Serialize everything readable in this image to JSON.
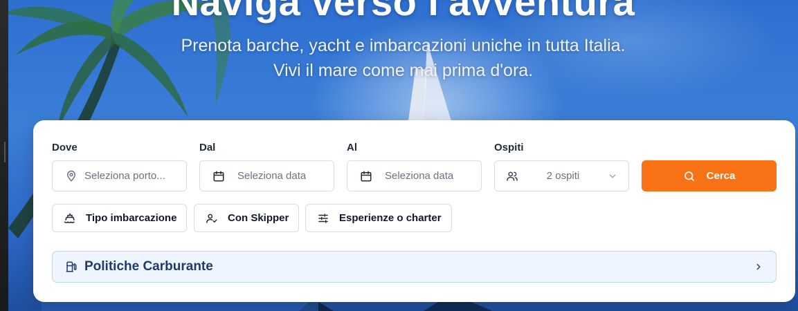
{
  "hero": {
    "title": "Naviga verso l'avventura",
    "subtitle_line1": "Prenota barche, yacht e imbarcazioni uniche in tutta Italia.",
    "subtitle_line2": "Vivi il mare come mai prima d'ora."
  },
  "search": {
    "where": {
      "label": "Dove",
      "placeholder": "Seleziona porto..."
    },
    "from": {
      "label": "Dal",
      "placeholder": "Seleziona data"
    },
    "to": {
      "label": "Al",
      "placeholder": "Seleziona data"
    },
    "guests": {
      "label": "Ospiti",
      "value": "2 ospiti"
    },
    "submit_label": "Cerca"
  },
  "filters": [
    {
      "label": "Tipo imbarcazione",
      "icon": "boat-icon"
    },
    {
      "label": "Con Skipper",
      "icon": "user-check-icon"
    },
    {
      "label": "Esperienze o charter",
      "icon": "sliders-icon"
    }
  ],
  "fuel_policy": {
    "label": "Politiche Carburante",
    "icon": "fuel-icon"
  },
  "colors": {
    "accent": "#f97316",
    "info_bg": "#eef5fe",
    "info_text": "#1e3a6e"
  }
}
